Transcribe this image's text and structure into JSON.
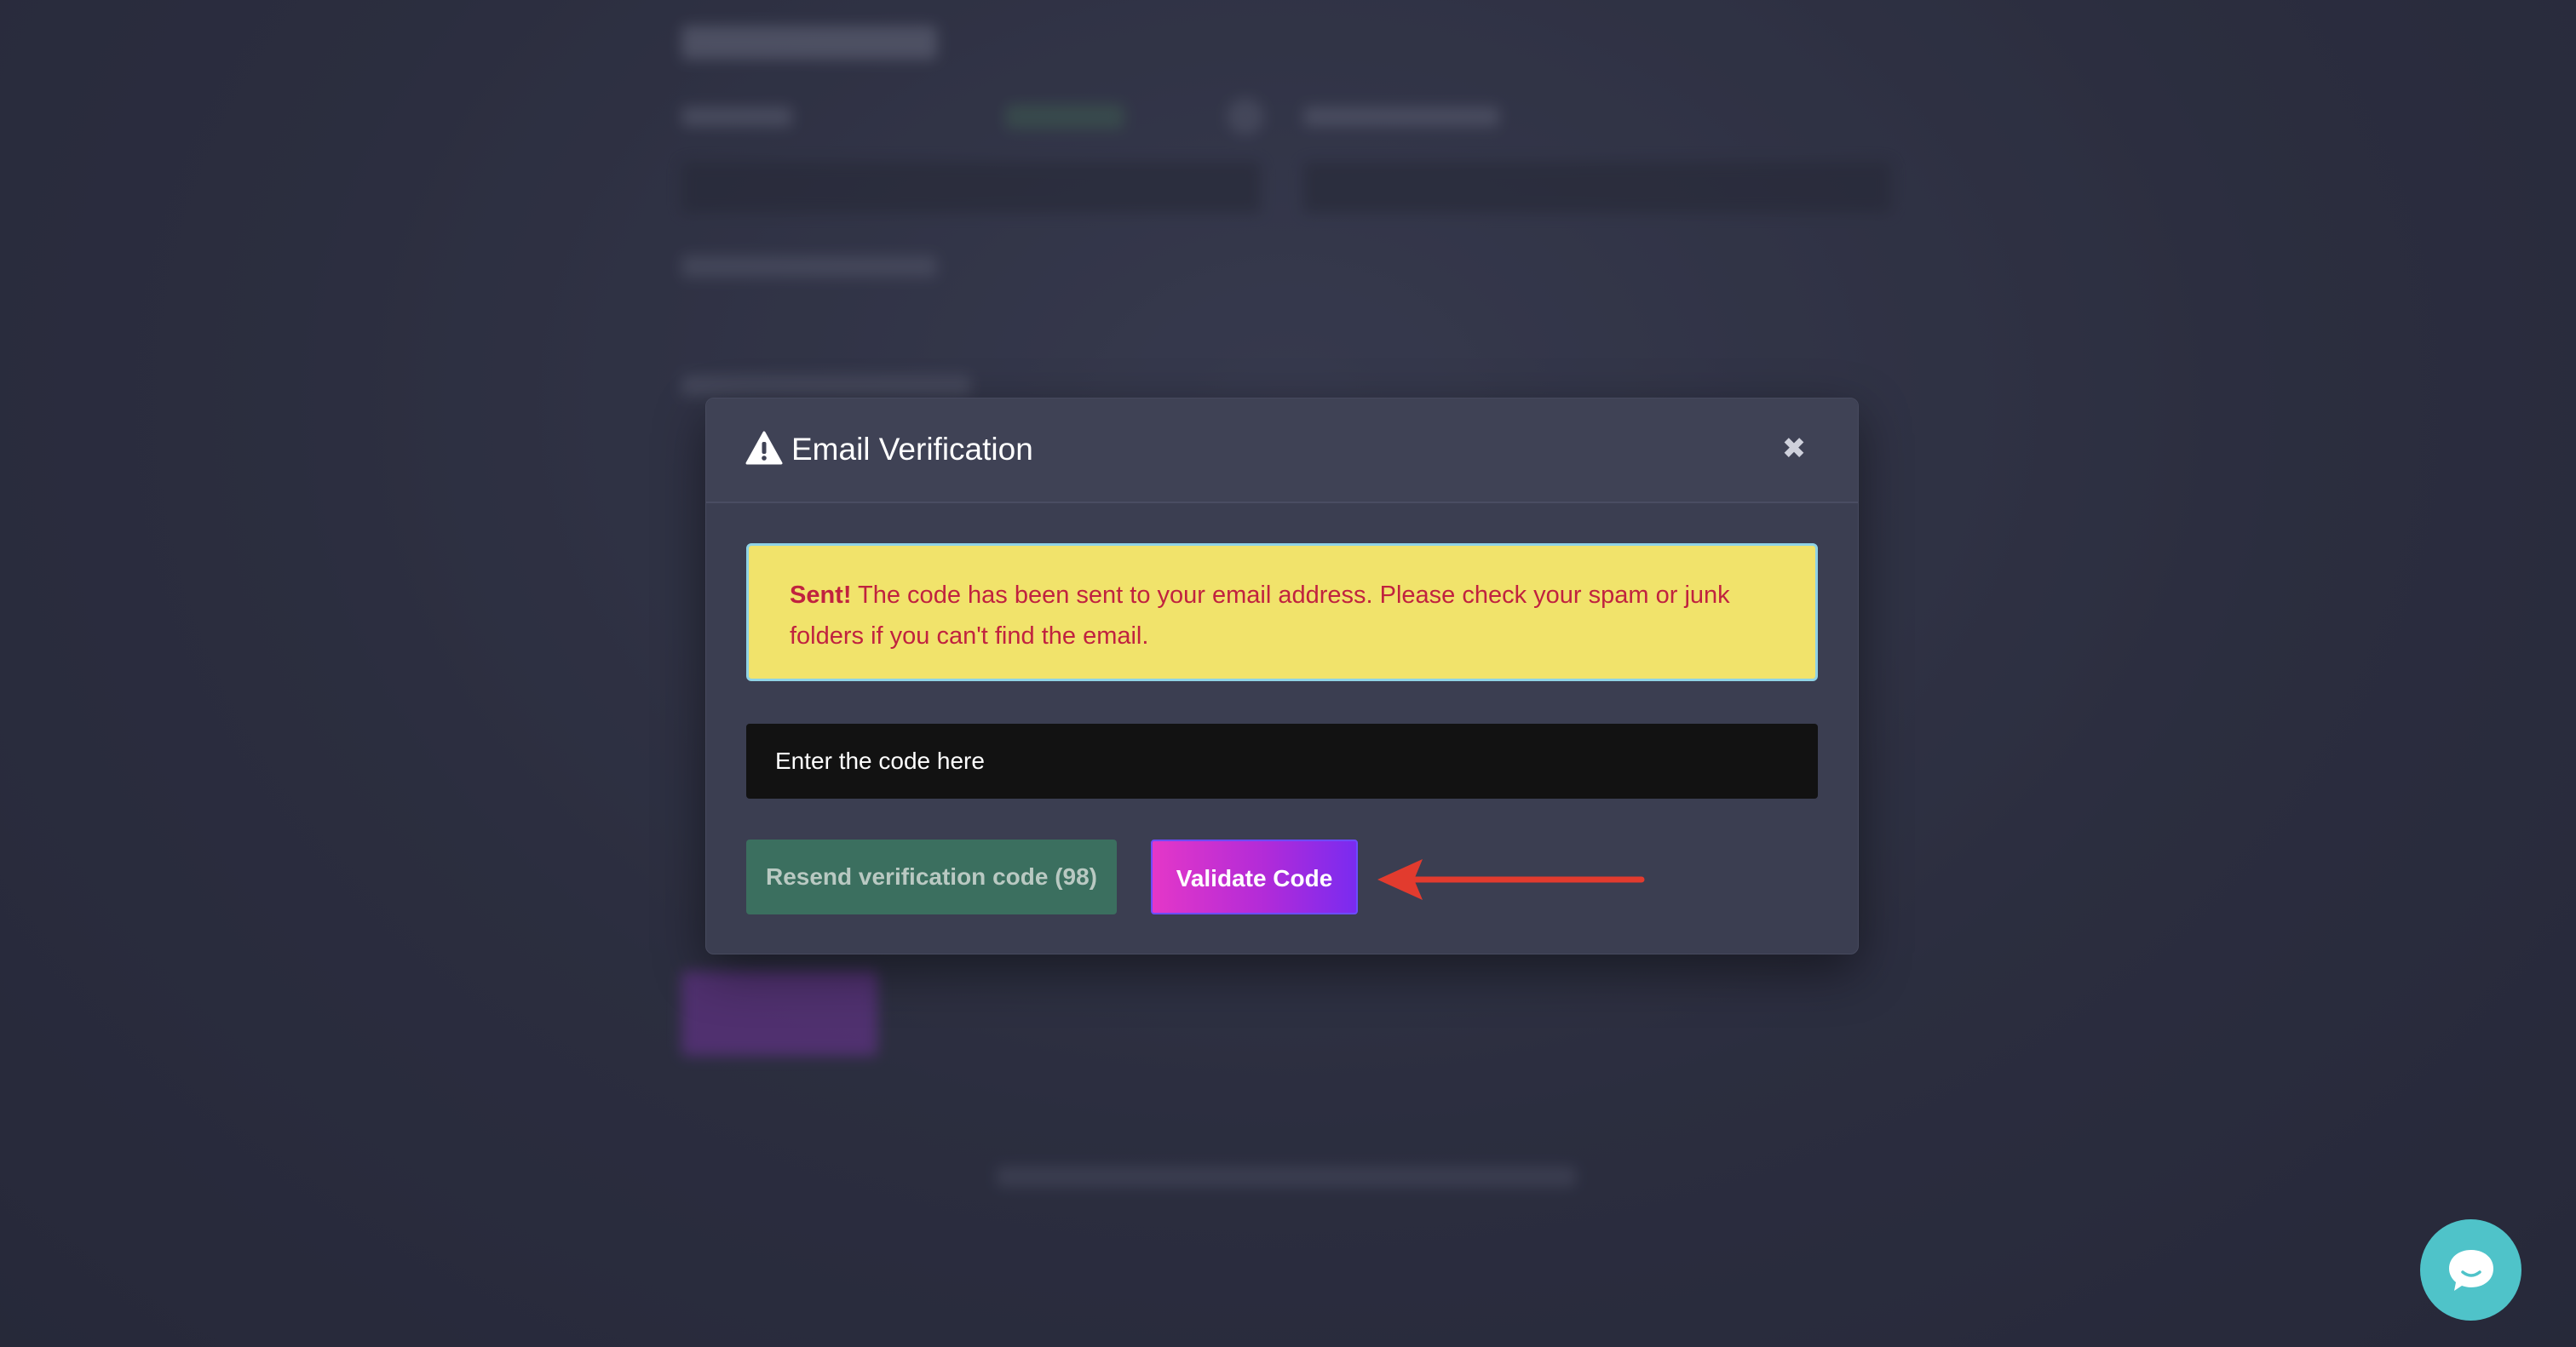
{
  "modal": {
    "title": "Email Verification",
    "title_icon": "warning-icon",
    "close_icon": "close-icon",
    "close_symbol": "✖",
    "alert": {
      "strong": "Sent!",
      "message": " The code has been sent to your email address. Please check your spam or junk folders if you can't find the email.",
      "background": "#f1e36b",
      "text_color": "#c0223f"
    },
    "code_input": {
      "value": "",
      "placeholder": "Enter the code here"
    },
    "resend_button": {
      "label": "Resend verification code (98)",
      "color": "#3b6f5f"
    },
    "validate_button": {
      "label": "Validate Code",
      "gradient": [
        "#e437c8",
        "#7a2bf0"
      ]
    }
  },
  "annotation": {
    "icon": "red-arrow-icon",
    "color": "#e23b2e"
  },
  "chat_widget": {
    "icon": "chat-bubble-icon",
    "color": "#4fc3c9"
  }
}
